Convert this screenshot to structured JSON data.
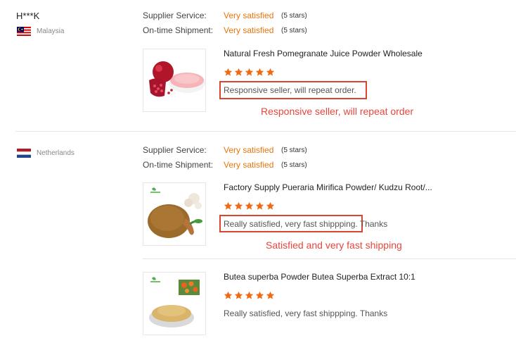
{
  "reviews": [
    {
      "buyer": "H***K",
      "country": "Malaysia",
      "ratings": [
        {
          "label": "Supplier Service:",
          "value": "Very satisfied",
          "stars_text": "(5 stars)"
        },
        {
          "label": "On-time Shipment:",
          "value": "Very satisfied",
          "stars_text": "(5 stars)"
        }
      ],
      "products": [
        {
          "title": "Natural Fresh Pomegranate Juice Powder Wholesale",
          "stars": 5,
          "review": "Responsive seller, will repeat order.",
          "annotation": "Responsive seller, will repeat order"
        }
      ]
    },
    {
      "buyer": "",
      "country": "Netherlands",
      "ratings": [
        {
          "label": "Supplier Service:",
          "value": "Very satisfied",
          "stars_text": "(5 stars)"
        },
        {
          "label": "On-time Shipment:",
          "value": "Very satisfied",
          "stars_text": "(5 stars)"
        }
      ],
      "products": [
        {
          "title": "Factory Supply Pueraria Mirifica Powder/ Kudzu Root/...",
          "stars": 5,
          "review_main": "Really satisfied, very fast shippping.",
          "review_tail": " Thanks",
          "annotation": "Satisfied and very fast shipping"
        },
        {
          "title": "Butea superba Powder Butea Superba Extract 10:1",
          "stars": 5,
          "review": "Really satisfied, very fast shippping. Thanks"
        }
      ]
    }
  ],
  "colors": {
    "accent": "#e8760c",
    "highlight": "#d9462e",
    "annotation": "#e8453c",
    "star": "#f06a13"
  },
  "icons": {
    "malaysia_flag": "malaysia-flag-icon",
    "netherlands_flag": "netherlands-flag-icon",
    "star": "star-icon"
  }
}
